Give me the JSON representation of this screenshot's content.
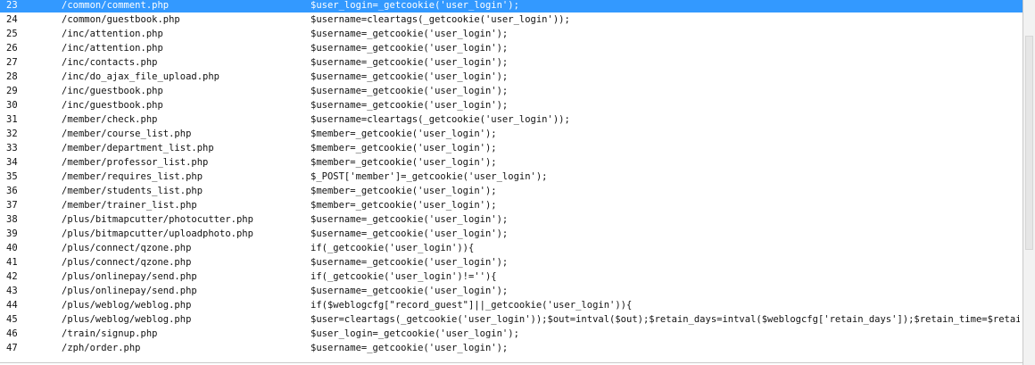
{
  "results": {
    "selected_index": 0,
    "rows": [
      {
        "num": "23",
        "file": "/common/comment.php",
        "code": "$user_login=_getcookie('user_login');"
      },
      {
        "num": "24",
        "file": "/common/guestbook.php",
        "code": "$username=cleartags(_getcookie('user_login'));"
      },
      {
        "num": "25",
        "file": "/inc/attention.php",
        "code": "$username=_getcookie('user_login');"
      },
      {
        "num": "26",
        "file": "/inc/attention.php",
        "code": "$username=_getcookie('user_login');"
      },
      {
        "num": "27",
        "file": "/inc/contacts.php",
        "code": "$username=_getcookie('user_login');"
      },
      {
        "num": "28",
        "file": "/inc/do_ajax_file_upload.php",
        "code": "$username=_getcookie('user_login');"
      },
      {
        "num": "29",
        "file": "/inc/guestbook.php",
        "code": "$username=_getcookie('user_login');"
      },
      {
        "num": "30",
        "file": "/inc/guestbook.php",
        "code": "$username=_getcookie('user_login');"
      },
      {
        "num": "31",
        "file": "/member/check.php",
        "code": "$username=cleartags(_getcookie('user_login'));"
      },
      {
        "num": "32",
        "file": "/member/course_list.php",
        "code": "$member=_getcookie('user_login');"
      },
      {
        "num": "33",
        "file": "/member/department_list.php",
        "code": "$member=_getcookie('user_login');"
      },
      {
        "num": "34",
        "file": "/member/professor_list.php",
        "code": "$member=_getcookie('user_login');"
      },
      {
        "num": "35",
        "file": "/member/requires_list.php",
        "code": "$_POST['member']=_getcookie('user_login');"
      },
      {
        "num": "36",
        "file": "/member/students_list.php",
        "code": "$member=_getcookie('user_login');"
      },
      {
        "num": "37",
        "file": "/member/trainer_list.php",
        "code": "$member=_getcookie('user_login');"
      },
      {
        "num": "38",
        "file": "/plus/bitmapcutter/photocutter.php",
        "code": "$username=_getcookie('user_login');"
      },
      {
        "num": "39",
        "file": "/plus/bitmapcutter/uploadphoto.php",
        "code": "$username=_getcookie('user_login');"
      },
      {
        "num": "40",
        "file": "/plus/connect/qzone.php",
        "code": "if(_getcookie('user_login')){"
      },
      {
        "num": "41",
        "file": "/plus/connect/qzone.php",
        "code": "$username=_getcookie('user_login');"
      },
      {
        "num": "42",
        "file": "/plus/onlinepay/send.php",
        "code": "if(_getcookie('user_login')!=''){"
      },
      {
        "num": "43",
        "file": "/plus/onlinepay/send.php",
        "code": "$username=_getcookie('user_login');"
      },
      {
        "num": "44",
        "file": "/plus/weblog/weblog.php",
        "code": "if($weblogcfg[\"record_guest\"]||_getcookie('user_login')){"
      },
      {
        "num": "45",
        "file": "/plus/weblog/weblog.php",
        "code": "$user=cleartags(_getcookie('user_login'));$out=intval($out);$retain_days=intval($weblogcfg['retain_days']);$retain_time=$retain_d..."
      },
      {
        "num": "46",
        "file": "/train/signup.php",
        "code": "$user_login=_getcookie('user_login');"
      },
      {
        "num": "47",
        "file": "/zph/order.php",
        "code": "$username=_getcookie('user_login');"
      }
    ]
  },
  "colors": {
    "selection": "#3399ff",
    "text": "#111111",
    "background": "#ffffff"
  }
}
